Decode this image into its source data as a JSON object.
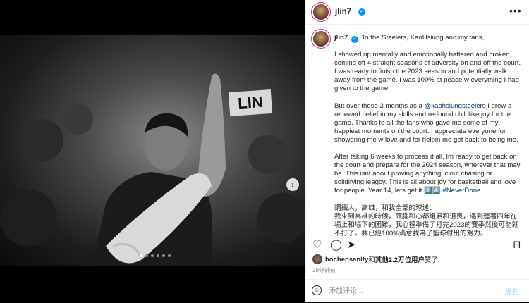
{
  "post": {
    "username": "jlin7",
    "verified_mark": "✓",
    "more_icon": "•••"
  },
  "media": {
    "sign_text": "LIN",
    "next_icon": "›",
    "carousel_total": 6,
    "carousel_active": 1
  },
  "caption": {
    "username": "jlin7",
    "p1": "To the Steelers, KaoHsiung and my fans,",
    "p2": "I showed up mentally and emotionally battered and broken, coming off 4 straight seasons of adversity on and off the court. I was ready to finish the 2023 season and potentially walk away from the game. I was 100% at peace w everything I had given to the game.",
    "p3_a": "But over those 3 months as a ",
    "p3_tag": "@kaohsiungsteelers",
    "p3_b": " I grew a renewed belief in my skills and re-found childlike joy for the game. Thanks to all the fans who gave me some of my happiest moments on the court. I appreciate everyone for showering me w love and for helpin me get back to being me.",
    "p4_a": "After taking 6 weeks to process it all, Im ready to get back on the court and prepare for the 2024 season, wherever that may be. This isnt about proving anything, clout chasing or solidifying leagcy. This is all about joy for basketball and love for people. Year 14, lets get it 1️⃣4️⃣ ",
    "p4_tag": "#NeverDone",
    "p5": "鋼鐵人，高雄，和我全部的球迷：\n我來到高雄的時候，頭腦和心都組累和沮喪，遇到連著四年在場上和場下的困難，我心裡準備了打完2023的賽季然後可能就不打了。我已經100%滿意我為了籃球付出的努力。"
  },
  "actions": {
    "like_icon": "♡",
    "comment_icon": "◯",
    "share_icon": "➤",
    "save_icon": "⊓"
  },
  "likes": {
    "user": "hochensanity",
    "mid": "和",
    "others": "其他2.2万位用户",
    "suffix": "赞了"
  },
  "time": "29分钟前",
  "comment": {
    "emoji_icon": "☺",
    "placeholder": "添加评论...",
    "post_label": "发布"
  }
}
